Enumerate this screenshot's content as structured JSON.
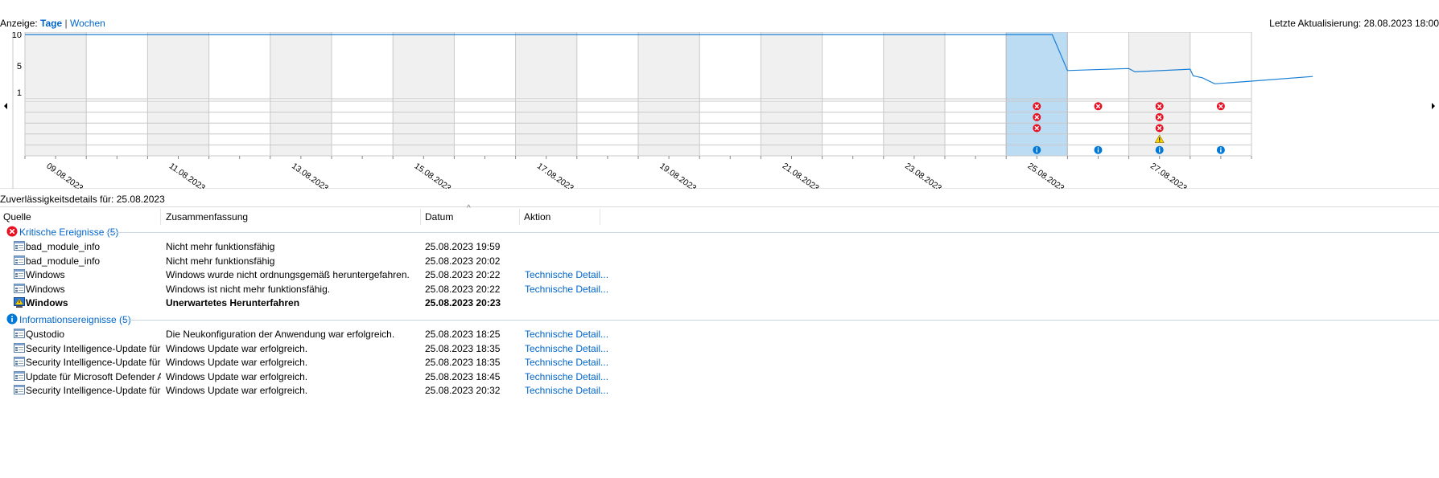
{
  "header": {
    "view_label": "Anzeige:",
    "view_days": "Tage",
    "view_sep": "|",
    "view_weeks": "Wochen",
    "last_update": "Letzte Aktualisierung: 28.08.2023 18:00"
  },
  "chart": {
    "y_ticks": [
      "10",
      "5",
      "1"
    ],
    "date_labels": [
      "09.08.2023",
      "11.08.2023",
      "13.08.2023",
      "15.08.2023",
      "17.08.2023",
      "19.08.2023",
      "21.08.2023",
      "23.08.2023",
      "25.08.2023",
      "27.08.2023"
    ],
    "columns": 20,
    "selected_column": 16,
    "event_rows": 5,
    "events": [
      {
        "col": 16,
        "row": 0,
        "type": "error"
      },
      {
        "col": 16,
        "row": 1,
        "type": "error"
      },
      {
        "col": 16,
        "row": 2,
        "type": "error"
      },
      {
        "col": 16,
        "row": 4,
        "type": "info"
      },
      {
        "col": 17,
        "row": 0,
        "type": "error"
      },
      {
        "col": 17,
        "row": 4,
        "type": "info"
      },
      {
        "col": 18,
        "row": 0,
        "type": "error"
      },
      {
        "col": 18,
        "row": 1,
        "type": "error"
      },
      {
        "col": 18,
        "row": 2,
        "type": "error"
      },
      {
        "col": 18,
        "row": 3,
        "type": "warning"
      },
      {
        "col": 18,
        "row": 4,
        "type": "info"
      },
      {
        "col": 19,
        "row": 0,
        "type": "error"
      },
      {
        "col": 19,
        "row": 4,
        "type": "info"
      }
    ],
    "stability_index": [
      {
        "day": 0,
        "value": 10
      },
      {
        "day": 16.75,
        "value": 10
      },
      {
        "day": 17,
        "value": 4.3
      },
      {
        "day": 18.0,
        "value": 4.6
      },
      {
        "day": 18.1,
        "value": 4.1
      },
      {
        "day": 19,
        "value": 4.5
      },
      {
        "day": 19.05,
        "value": 3.5
      },
      {
        "day": 19.2,
        "value": 3.2
      },
      {
        "day": 19.4,
        "value": 2.3
      },
      {
        "day": 20.0,
        "value": 2.7
      },
      {
        "day": 21,
        "value": 3.4
      }
    ],
    "colors": {
      "line": "#1a7fd4",
      "selected": "#bcdcf4",
      "alt_band": "#f0f0f0",
      "grid": "#c8c8c8",
      "error": "#e81123",
      "info": "#0078d7",
      "warning": "#ffd700"
    }
  },
  "details": {
    "label": "Zuverlässigkeitsdetails für: 25.08.2023"
  },
  "table": {
    "headers": {
      "source": "Quelle",
      "summary": "Zusammenfassung",
      "date": "Datum",
      "action": "Aktion"
    },
    "groups": [
      {
        "title": "Kritische Ereignisse (5)",
        "icon": "error-icon",
        "rows": [
          {
            "source": "bad_module_info",
            "summary": "Nicht mehr funktionsfähig",
            "date": "25.08.2023 19:59",
            "action": "",
            "icon": "app-icon",
            "bold": false
          },
          {
            "source": "bad_module_info",
            "summary": "Nicht mehr funktionsfähig",
            "date": "25.08.2023 20:02",
            "action": "",
            "icon": "app-icon",
            "bold": false
          },
          {
            "source": "Windows",
            "summary": "Windows wurde nicht ordnungsgemäß heruntergefahren.",
            "date": "25.08.2023 20:22",
            "action": "Technische Detail...",
            "icon": "app-icon",
            "bold": false
          },
          {
            "source": "Windows",
            "summary": "Windows ist nicht mehr funktionsfähig.",
            "date": "25.08.2023 20:22",
            "action": "Technische Detail...",
            "icon": "app-icon",
            "bold": false
          },
          {
            "source": "Windows",
            "summary": "Unerwartetes Herunterfahren",
            "date": "25.08.2023 20:23",
            "action": "",
            "icon": "shutdown-icon",
            "bold": true
          }
        ]
      },
      {
        "title": "Informationsereignisse (5)",
        "icon": "info-icon",
        "rows": [
          {
            "source": "Qustodio",
            "summary": "Die Neukonfiguration der Anwendung war erfolgreich.",
            "date": "25.08.2023 18:25",
            "action": "Technische Detail...",
            "icon": "app-icon",
            "bold": false
          },
          {
            "source": "Security Intelligence-Update für M...",
            "summary": "Windows Update war erfolgreich.",
            "date": "25.08.2023 18:35",
            "action": "Technische Detail...",
            "icon": "app-icon",
            "bold": false
          },
          {
            "source": "Security Intelligence-Update für M...",
            "summary": "Windows Update war erfolgreich.",
            "date": "25.08.2023 18:35",
            "action": "Technische Detail...",
            "icon": "app-icon",
            "bold": false
          },
          {
            "source": "Update für Microsoft Defender An...",
            "summary": "Windows Update war erfolgreich.",
            "date": "25.08.2023 18:45",
            "action": "Technische Detail...",
            "icon": "app-icon",
            "bold": false
          },
          {
            "source": "Security Intelligence-Update für M...",
            "summary": "Windows Update war erfolgreich.",
            "date": "25.08.2023 20:32",
            "action": "Technische Detail...",
            "icon": "app-icon",
            "bold": false
          }
        ]
      }
    ]
  }
}
